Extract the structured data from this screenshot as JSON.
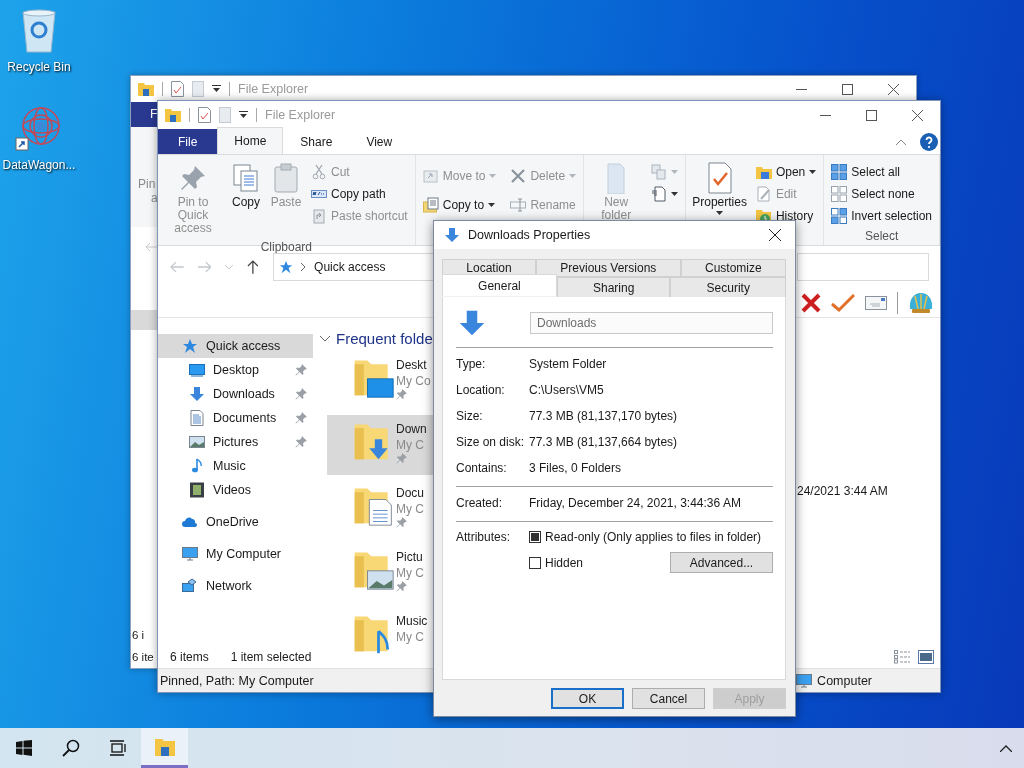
{
  "desktop": {
    "icons": [
      {
        "label": "Recycle Bin"
      },
      {
        "label": "DataWagon..."
      }
    ]
  },
  "back_window": {
    "title": "File Explorer",
    "file_tab": "F",
    "ribbon_texts": [
      "Pin",
      "a"
    ],
    "status_texts": [
      "6 i",
      "6 ite"
    ]
  },
  "window": {
    "title": "File Explorer",
    "tabs": [
      {
        "label": "File",
        "kind": "file",
        "selected": false
      },
      {
        "label": "Home",
        "kind": "tab",
        "selected": true
      },
      {
        "label": "Share",
        "kind": "tab",
        "selected": false
      },
      {
        "label": "View",
        "kind": "tab",
        "selected": false
      }
    ],
    "ribbon": {
      "groups": [
        {
          "label": "Clipboard",
          "items": [
            {
              "kind": "large",
              "label": "Pin to Quick access",
              "disabled": true,
              "dropdown": false
            },
            {
              "kind": "large",
              "label": "Copy",
              "disabled": false,
              "dropdown": false
            },
            {
              "kind": "large",
              "label": "Paste",
              "disabled": true,
              "dropdown": false
            },
            {
              "kind": "small",
              "label": "Cut",
              "disabled": true,
              "dropdown": false
            },
            {
              "kind": "small",
              "label": "Copy path",
              "disabled": false,
              "dropdown": false
            },
            {
              "kind": "small",
              "label": "Paste shortcut",
              "disabled": true,
              "dropdown": false
            }
          ]
        },
        {
          "items": [
            {
              "kind": "small",
              "label": "Move to",
              "disabled": true,
              "dropdown": true
            },
            {
              "kind": "small",
              "label": "Copy to",
              "disabled": false,
              "dropdown": true
            },
            {
              "kind": "small",
              "label": "Delete",
              "disabled": true,
              "dropdown": true
            },
            {
              "kind": "small",
              "label": "Rename",
              "disabled": true,
              "dropdown": false
            }
          ]
        },
        {
          "items": [
            {
              "kind": "large",
              "label": "New folder",
              "disabled": true,
              "dropdown": false
            },
            {
              "kind": "icon",
              "disabled": true,
              "dropdown": true
            },
            {
              "kind": "icon",
              "disabled": false,
              "dropdown": true
            }
          ]
        },
        {
          "items": [
            {
              "kind": "large",
              "label": "Properties",
              "disabled": false,
              "dropdown": true
            },
            {
              "kind": "small",
              "label": "Open",
              "disabled": false,
              "dropdown": true
            },
            {
              "kind": "small",
              "label": "Edit",
              "disabled": true,
              "dropdown": false
            },
            {
              "kind": "small",
              "label": "History",
              "disabled": false,
              "dropdown": false
            }
          ]
        },
        {
          "label": "Select",
          "items": [
            {
              "kind": "small",
              "label": "Select all",
              "disabled": false,
              "dropdown": false
            },
            {
              "kind": "small",
              "label": "Select none",
              "disabled": false,
              "dropdown": false
            },
            {
              "kind": "small",
              "label": "Invert selection",
              "disabled": false,
              "dropdown": false
            }
          ]
        }
      ]
    },
    "address": "Quick access",
    "sidebar": {
      "items": [
        {
          "label": "Quick access",
          "selected": true,
          "children": [
            {
              "label": "Desktop",
              "pinned": true,
              "selected": false
            },
            {
              "label": "Downloads",
              "pinned": true,
              "selected": false
            },
            {
              "label": "Documents",
              "pinned": true,
              "selected": false
            },
            {
              "label": "Pictures",
              "pinned": true,
              "selected": false
            },
            {
              "label": "Music",
              "pinned": false,
              "selected": false
            },
            {
              "label": "Videos",
              "pinned": false,
              "selected": false
            }
          ]
        },
        {
          "label": "OneDrive",
          "selected": false
        },
        {
          "label": "My Computer",
          "selected": false
        },
        {
          "label": "Network",
          "selected": false
        }
      ]
    },
    "content": {
      "header": "Frequent folde",
      "tiles": [
        {
          "name": "Deskt",
          "location": "My Co",
          "pinned": true,
          "selected": false
        },
        {
          "name": "Down",
          "location": "My C",
          "pinned": true,
          "selected": true
        },
        {
          "name": "Docu",
          "location": "My C",
          "pinned": true,
          "selected": false
        },
        {
          "name": "Pictu",
          "location": "My C",
          "pinned": true,
          "selected": false
        },
        {
          "name": "Music",
          "location": "My C",
          "pinned": false,
          "selected": false
        }
      ],
      "modified": "24/2021 3:44 AM"
    },
    "status": {
      "count": "6 items",
      "selection": "1 item selected"
    },
    "details_bar": {
      "text": "Pinned, Path: My Computer",
      "location": "Computer"
    }
  },
  "dialog": {
    "title": "Downloads Properties",
    "tab_rows": [
      [
        {
          "label": "Location",
          "selected": false
        },
        {
          "label": "Previous Versions",
          "selected": false
        },
        {
          "label": "Customize",
          "selected": false
        }
      ],
      [
        {
          "label": "General",
          "selected": true
        },
        {
          "label": "Sharing",
          "selected": false
        },
        {
          "label": "Security",
          "selected": false
        }
      ]
    ],
    "name": {
      "value": "Downloads",
      "disabled": true
    },
    "sections": [
      [
        {
          "label": "Type:",
          "value": "System Folder"
        },
        {
          "label": "Location:",
          "value": "C:\\Users\\VM5"
        },
        {
          "label": "Size:",
          "value": "77.3 MB (81,137,170 bytes)"
        },
        {
          "label": "Size on disk:",
          "value": "77.3 MB (81,137,664 bytes)"
        },
        {
          "label": "Contains:",
          "value": "3 Files, 0 Folders"
        }
      ],
      [
        {
          "label": "Created:",
          "value": "Friday, December 24, 2021, 3:44:36 AM"
        }
      ]
    ],
    "attributes_label": "Attributes:",
    "attributes": [
      {
        "label": "Read-only (Only applies to files in folder)",
        "checked": false,
        "indeterminate": true
      },
      {
        "label": "Hidden",
        "checked": false,
        "indeterminate": false
      }
    ],
    "advanced_button": "Advanced...",
    "buttons": [
      {
        "label": "OK",
        "kind": "default",
        "disabled": false
      },
      {
        "label": "Cancel",
        "kind": "normal",
        "disabled": false
      },
      {
        "label": "Apply",
        "kind": "normal",
        "disabled": true
      }
    ]
  },
  "taskbar": {
    "items": [
      {
        "kind": "start",
        "active": false
      },
      {
        "kind": "search",
        "active": false
      },
      {
        "kind": "taskview",
        "active": false
      },
      {
        "kind": "explorer",
        "active": true
      }
    ]
  }
}
